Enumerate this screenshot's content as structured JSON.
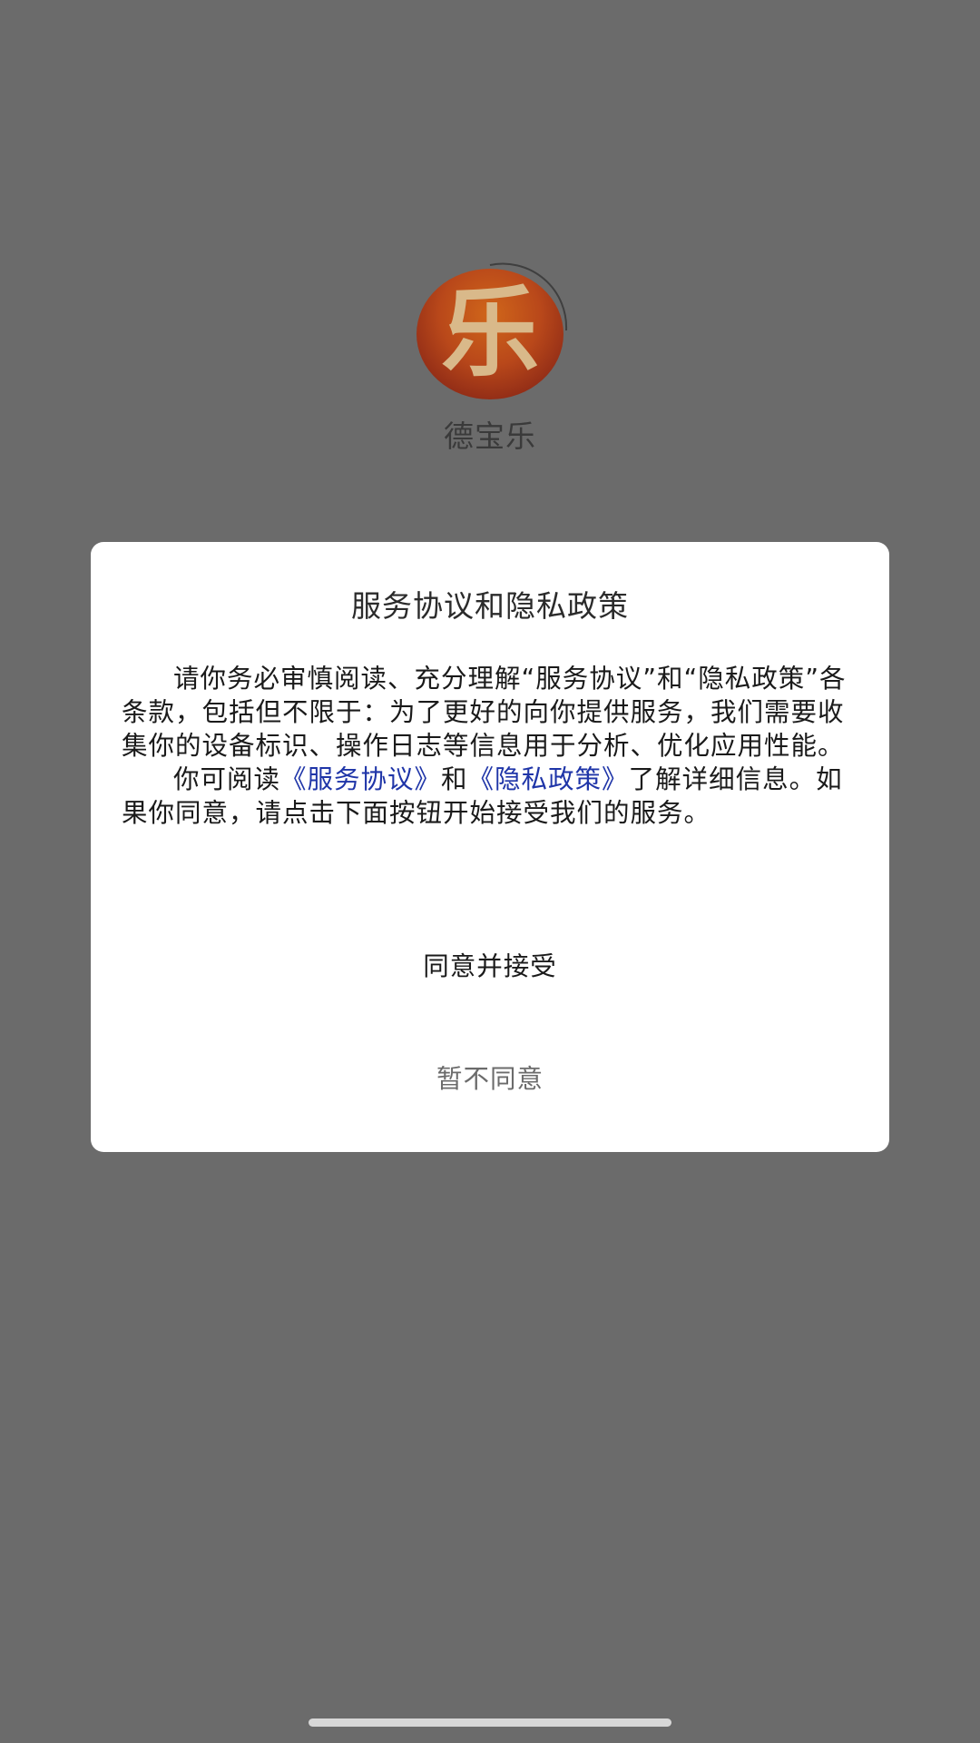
{
  "splash": {
    "logo_char": "乐",
    "app_name": "德宝乐"
  },
  "dialog": {
    "title": "服务协议和隐私政策",
    "paragraph1": "请你务必审慎阅读、充分理解“服务协议”和“隐私政策”各条款，包括但不限于：为了更好的向你提供服务，我们需要收集你的设备标识、操作日志等信息用于分析、优化应用性能。",
    "paragraph2_prefix": "你可阅读",
    "service_link": "《服务协议》",
    "paragraph2_and": "和",
    "privacy_link": "《隐私政策》",
    "paragraph2_suffix": "了解详细信息。如果你同意，请点击下面按钮开始接受我们的服务。",
    "agree_label": "同意并接受",
    "disagree_label": "暂不同意"
  },
  "colors": {
    "overlay_background": "#6b6b6b",
    "dialog_background": "#ffffff",
    "link": "#1f35a8",
    "disagree_text": "#6b6b6b"
  }
}
